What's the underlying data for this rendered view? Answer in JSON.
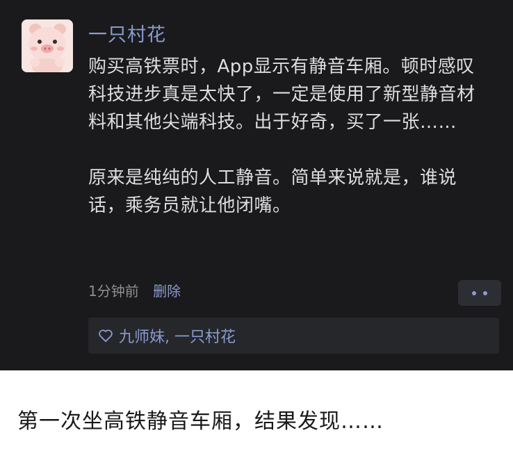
{
  "post": {
    "author": "一只村花",
    "paragraphs": [
      "购买高铁票时，App显示有静音车厢。顿时感叹科技进步真是太快了，一定是使用了新型静音材料和其他尖端科技。出于好奇，买了一张……",
      "原来是纯纯的人工静音。简单来说就是，谁说话，乘务员就让他闭嘴。"
    ],
    "time": "1分钟前",
    "delete_label": "删除",
    "likes": "九师妹, 一只村花"
  },
  "caption": "第一次坐高铁静音车厢，结果发现……",
  "colors": {
    "background_dark": "#1a1a1c",
    "link_blue": "#8a9ccf",
    "text_light": "#dedede"
  },
  "icons": [
    "pig-avatar",
    "heart-outline-icon",
    "more-dots-icon"
  ]
}
